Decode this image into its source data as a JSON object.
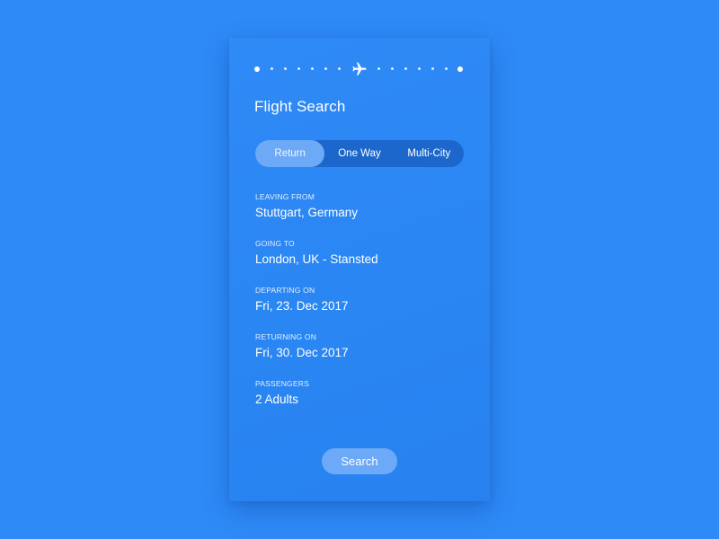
{
  "colors": {
    "background": "#2E8AF7",
    "card": "#2A86F3",
    "segment_track": "#1C67CC",
    "segment_active": "#6CA9F6",
    "button": "#6CA9F6",
    "text": "#FFFFFF"
  },
  "route": {
    "start_icon": "origin-dot-icon",
    "plane_icon": "airplane-icon",
    "end_icon": "destination-dot-icon"
  },
  "title": "Flight Search",
  "trip_type": {
    "selected": "Return",
    "options": [
      "Return",
      "One Way",
      "Multi-City"
    ]
  },
  "fields": {
    "leaving_from": {
      "label": "LEAVING FROM",
      "value": "Stuttgart, Germany"
    },
    "going_to": {
      "label": "GOING TO",
      "value": "London, UK - Stansted"
    },
    "departing_on": {
      "label": "DEPARTING ON",
      "value": "Fri, 23. Dec 2017"
    },
    "returning_on": {
      "label": "RETURNING ON",
      "value": "Fri, 30. Dec 2017"
    },
    "passengers": {
      "label": "PASSENGERS",
      "value": "2 Adults"
    }
  },
  "search_button": "Search"
}
